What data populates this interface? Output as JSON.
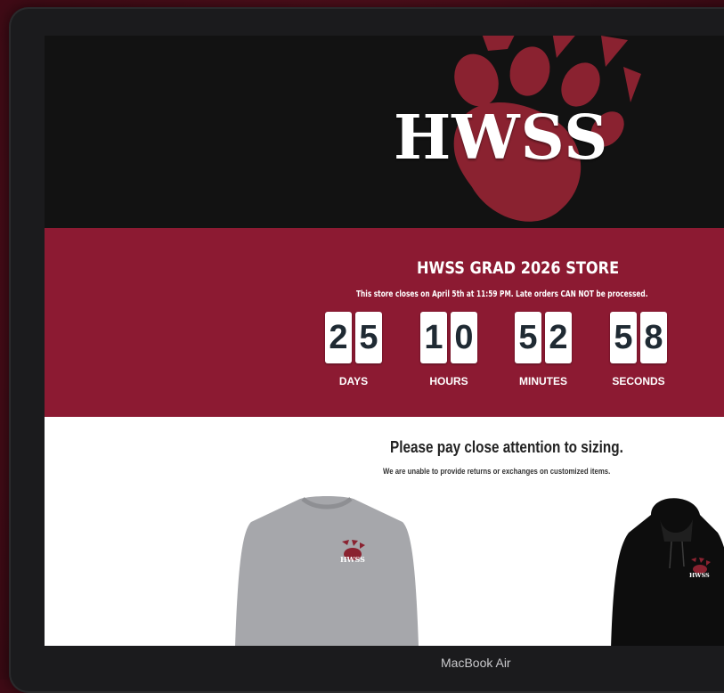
{
  "header": {
    "logo_text": "HWSS"
  },
  "store": {
    "title": "HWSS GRAD 2026 STORE",
    "note": "This store closes on April 5th at 11:59 PM. Late orders CAN NOT be processed."
  },
  "countdown": {
    "days": [
      "2",
      "5"
    ],
    "hours": [
      "1",
      "0"
    ],
    "minutes": [
      "5",
      "2"
    ],
    "seconds": [
      "5",
      "8"
    ],
    "labels": {
      "days": "DAYS",
      "hours": "HOURS",
      "minutes": "MINUTES",
      "seconds": "SECONDS"
    }
  },
  "sizing": {
    "title": "Please pay close attention to sizing.",
    "note": "We are unable to provide returns or exchanges on customized items."
  },
  "products": [
    {
      "name": "grey crewneck sweatshirt",
      "print_text": "HWSS"
    },
    {
      "name": "black hoodie",
      "print_text": "HWSS"
    }
  ],
  "device": {
    "caption": "MacBook Air"
  },
  "colors": {
    "maroon": "#8c1a32",
    "banner": "#121212",
    "digit_text": "#1f2a33"
  }
}
